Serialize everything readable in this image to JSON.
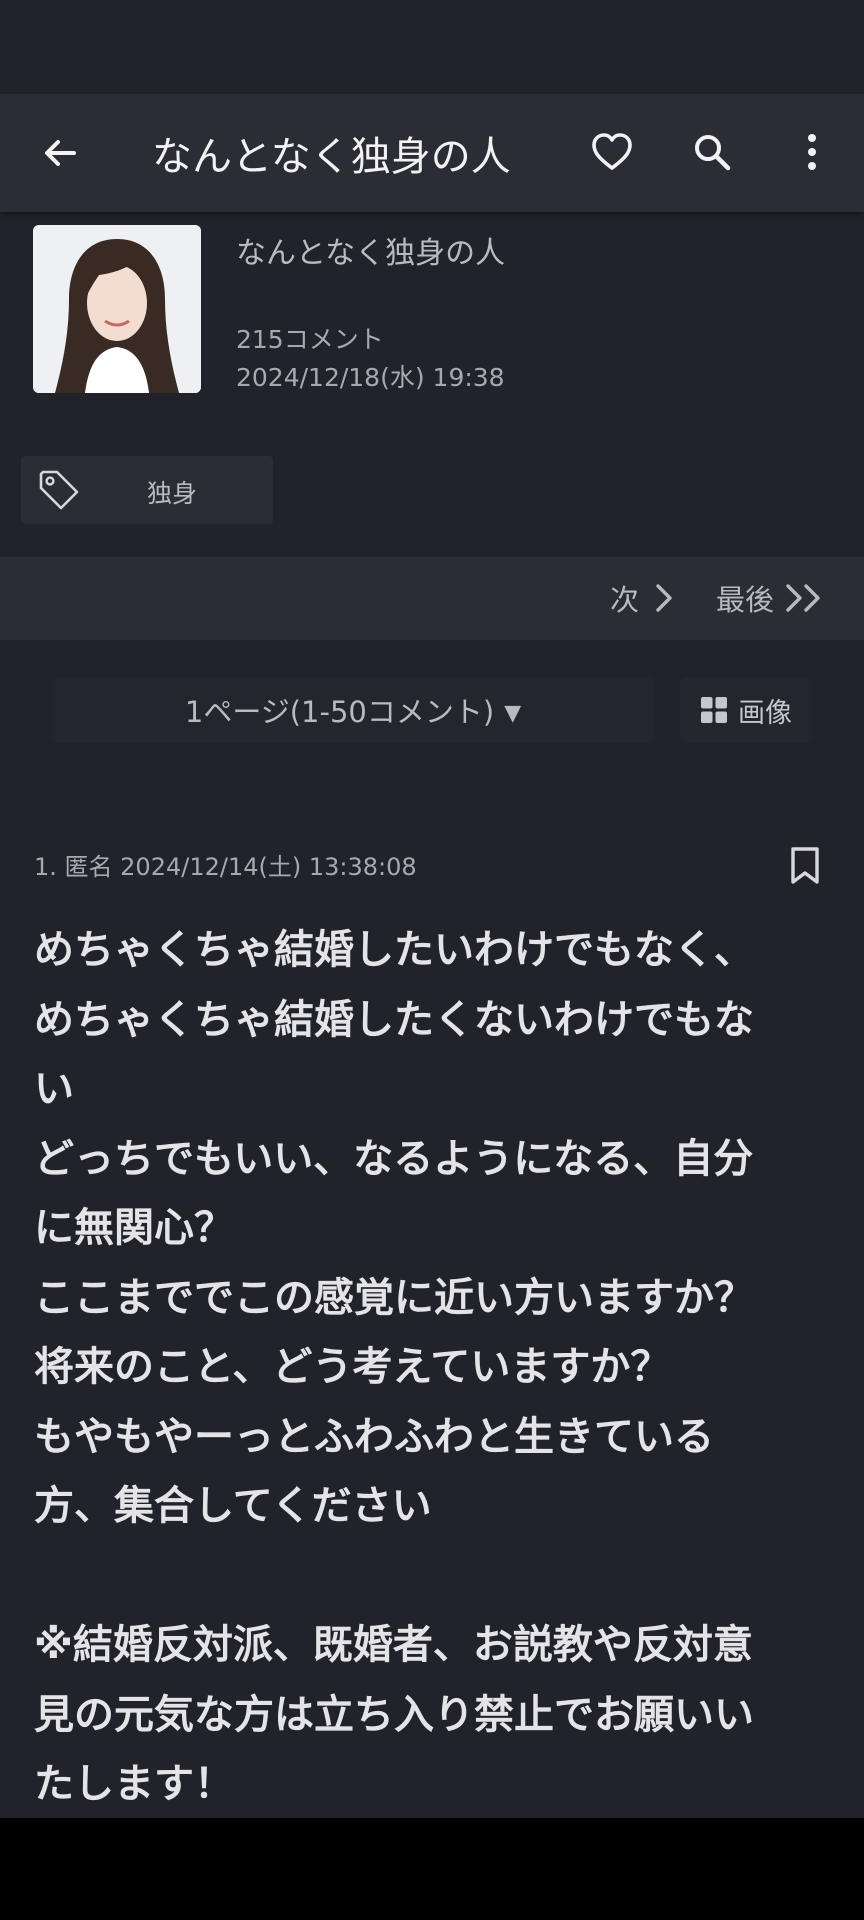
{
  "appbar": {
    "title": "なんとなく独身の人",
    "icons": [
      "back-arrow-icon",
      "heart-icon",
      "search-icon",
      "more-vert-icon"
    ]
  },
  "topic": {
    "title": "なんとなく独身の人",
    "comment_count": "215コメント",
    "date": "2024/12/18(水) 19:38"
  },
  "tag": {
    "label": "独身"
  },
  "pager": {
    "next_label": "次",
    "last_label": "最後"
  },
  "page_select": {
    "selected": "1ページ(1-50コメント)",
    "caret": "▼"
  },
  "image_button": {
    "label": "画像"
  },
  "comment": {
    "meta": "1. 匿名 2024/12/14(土) 13:38:08",
    "lines": [
      "めちゃくちゃ結婚したいわけでもなく、",
      "めちゃくちゃ結婚したくないわけでもな",
      "い",
      "どっちでもいい、なるようになる、自分",
      "に無関心？",
      "ここまででこの感覚に近い方いますか？",
      "将来のこと、どう考えていますか？",
      "もやもやーっとふわふわと生きている",
      "方、集合してください",
      "",
      "※結婚反対派、既婚者、お説教や反対意",
      "見の元気な方は立ち入り禁止でお願いい",
      "たします！"
    ]
  },
  "colors": {
    "background": "#22232a",
    "appbar": "#2c2d34",
    "muted_text": "#b9bac0",
    "body_text": "#e4e4e8"
  }
}
